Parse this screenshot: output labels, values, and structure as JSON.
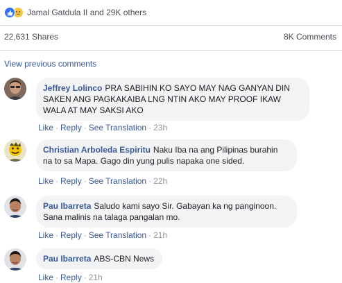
{
  "reactions": {
    "text": "Jamal Gatdula II and 29K others",
    "icons": [
      "like-icon",
      "sad-icon"
    ],
    "colors": {
      "like": "#2f6ff3",
      "sad": "#f7c744"
    }
  },
  "stats": {
    "shares": "22,631 Shares",
    "comments": "8K Comments"
  },
  "view_previous": "View previous comments",
  "actions": {
    "like": "Like",
    "reply": "Reply",
    "translate": "See Translation",
    "separator": "·"
  },
  "comments": [
    {
      "author": "Jeffrey Lolinco",
      "text": "PRA SABIHIN KO SAYO MAY NAG GANYAN DIN SAKEN ANG PAGKAKAIBA LNG NTIN AKO MAY PROOF IKAW WALA AT MAY SAKSI AKO",
      "time": "23h",
      "has_translation": true
    },
    {
      "author": "Christian Arboleda Espiritu",
      "text": "Naku Iba na ang Pilipinas burahin na to sa Mapa. Gago din yung pulis napaka one sided.",
      "time": "22h",
      "has_translation": true
    },
    {
      "author": "Pau Ibarreta",
      "text": "Saludo kami sayo Sir. Gabayan ka ng panginoon. Sana malinis na talaga pangalan mo.",
      "time": "21h",
      "has_translation": true
    },
    {
      "author": "Pau Ibarreta",
      "text": "ABS-CBN News",
      "time": "21h",
      "has_translation": false
    }
  ],
  "colors": {
    "link": "#385898",
    "muted": "#90949c",
    "bubble": "#f2f3f5",
    "divider": "#dadde1"
  }
}
